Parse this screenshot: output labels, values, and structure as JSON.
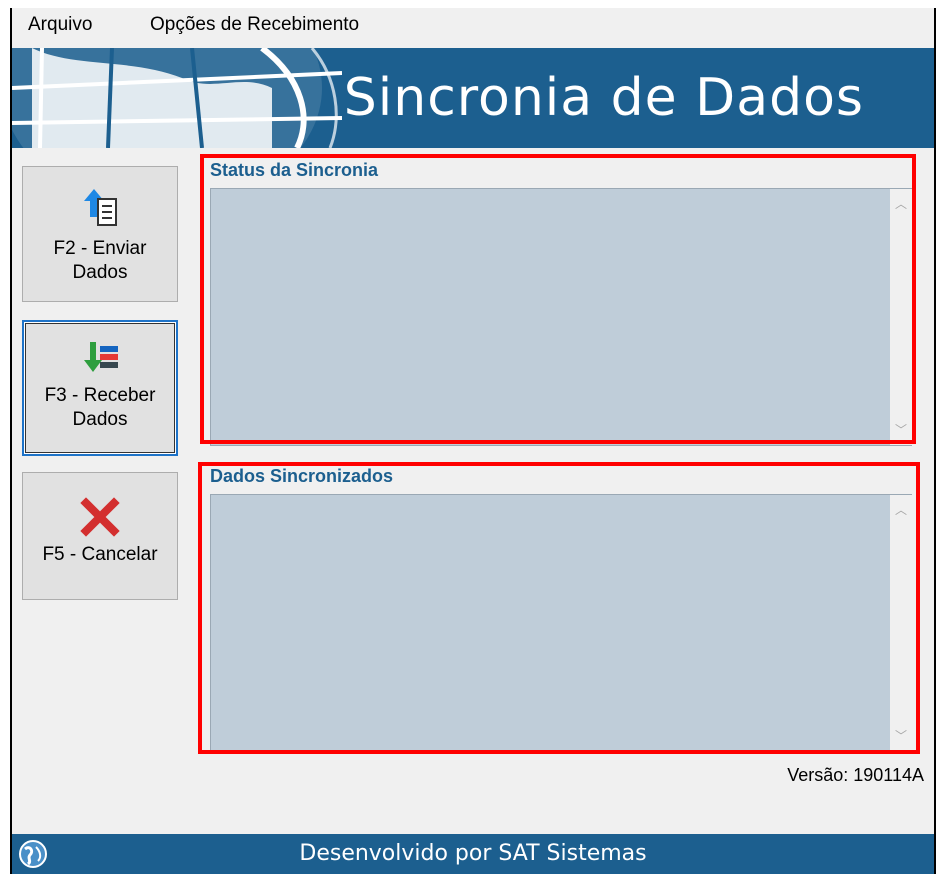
{
  "menu": {
    "items": [
      {
        "label": "Arquivo"
      },
      {
        "label": "Opções de Recebimento"
      }
    ]
  },
  "banner": {
    "title": "Sincronia de Dados"
  },
  "sidebar": {
    "buttons": [
      {
        "label": "F2 - Enviar\nDados",
        "icon": "upload-document-icon"
      },
      {
        "label": "F3 - Receber\nDados",
        "icon": "download-data-icon"
      },
      {
        "label": "F5 - Cancelar",
        "icon": "cancel-x-icon"
      }
    ]
  },
  "status": {
    "title": "Status da Sincronia",
    "text": ""
  },
  "synced": {
    "title": "Dados Sincronizados",
    "text": ""
  },
  "version": {
    "label": "Versão: 190114A"
  },
  "footer": {
    "text": "Desenvolvido por SAT Sistemas",
    "icon": "globe-icon"
  },
  "colors": {
    "brand": "#1c5f8f",
    "memo_bg": "#bfcdd9",
    "highlight": "#ff0000",
    "focus": "#1e73c8"
  }
}
